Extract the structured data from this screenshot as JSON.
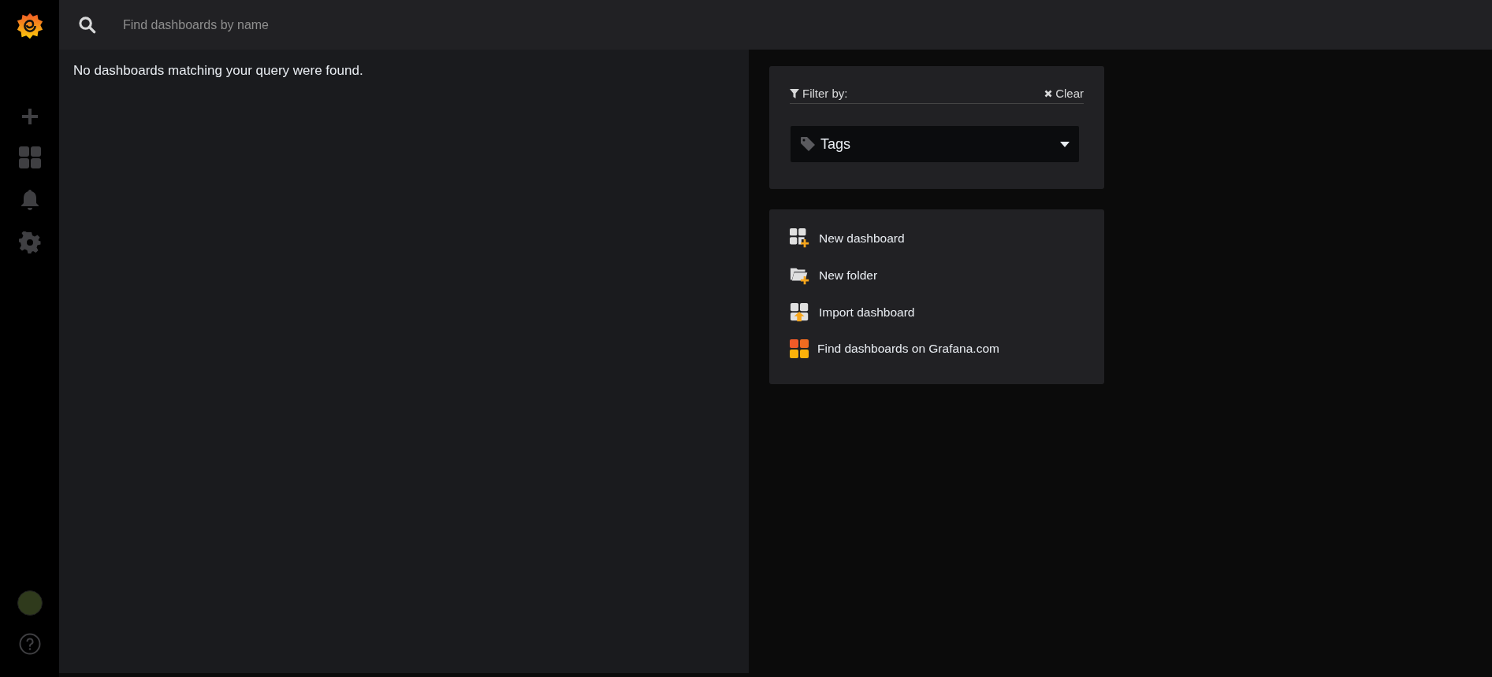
{
  "search": {
    "placeholder": "Find dashboards by name"
  },
  "results": {
    "message": "No dashboards matching your query were found."
  },
  "filter": {
    "label": "Filter by:",
    "clear": "Clear",
    "tags": {
      "placeholder": "Tags"
    }
  },
  "actions": [
    {
      "kind": "new-dashboard",
      "label": "New dashboard"
    },
    {
      "kind": "new-folder",
      "label": "New folder"
    },
    {
      "kind": "import",
      "label": "Import dashboard"
    },
    {
      "kind": "find",
      "label": "Find dashboards on Grafana.com"
    }
  ]
}
